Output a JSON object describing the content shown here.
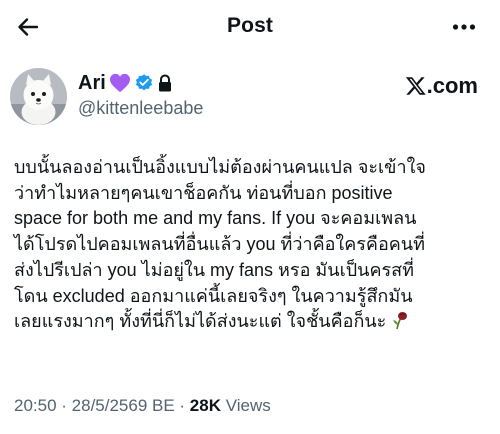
{
  "header": {
    "title": "Post"
  },
  "author": {
    "name": "Ari",
    "handle": "@kittenleebabe",
    "badge_icons": [
      "purple-heart-icon",
      "verified-badge-icon",
      "lock-icon"
    ]
  },
  "watermark": {
    "text": ".com"
  },
  "post": {
    "lines": [
      "บบนั้นลองอ่านเป็นอิ้งแบบไม่ต้องผ่านคนแปล จะเข้าใจ",
      "ว่าทำไมหลายๆคนเขาช็อคกัน ท่อนที่บอก positive",
      "space for both me and my fans. If you จะคอมเพลน",
      "ได้โปรดไปคอมเพลนที่อื่นแล้ว you ที่ว่าคือใครคือคนที่",
      "ส่งไปรีเปล่า you ไม่อยู่ใน my fans หรอ มันเป็นครสที่",
      "โดน excluded ออกมาแค่นี้เลยจริงๆ ในความรู้สึกมัน",
      "เลยแรงมากๆ ทั้งที่นี่ก็ไม่ได้ส่งนะแต่ ใจชั้นคือก็นะ"
    ],
    "trailing_emoji_icon": "wilted-flower-icon"
  },
  "meta": {
    "time": "20:50",
    "separator": " · ",
    "date": "28/5/2569 BE",
    "views_count": "28K",
    "views_label": " Views"
  },
  "colors": {
    "text": "#0f1419",
    "secondary": "#536471",
    "verified": "#1d9bf0",
    "heart": "#a45cf0"
  }
}
